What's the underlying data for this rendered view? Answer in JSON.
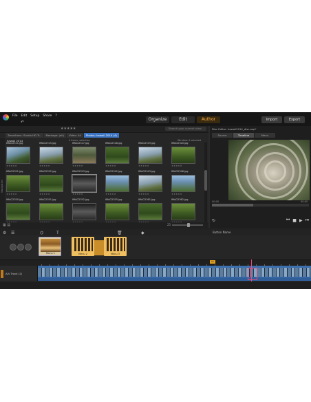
{
  "menu": [
    "File",
    "Edit",
    "Setup",
    "Share",
    "?"
  ],
  "modes": {
    "organize": "Organize",
    "edit": "Edit",
    "author": "Author"
  },
  "actions": {
    "import": "Import",
    "export": "Export"
  },
  "library": {
    "stars": "★★★★★",
    "search_placeholder": "Search your current view",
    "tabs": [
      "Transitions: Studio HD Tr..",
      "Montage: (all)",
      "Video: All",
      "Photos: hawaii 2014 (4)"
    ],
    "sub_header": "hawaii 2014",
    "info_left": "4 items, selection",
    "info_right": "Window: 4 selected",
    "navigation": "Navigation",
    "rows": [
      {
        "files": [
          "IMAG2311.jpg",
          "IMAG2315.jpg",
          "IMAG2317.jpg",
          "IMAG2318.jpg",
          "IMAG2319.jpg",
          "IMAG2320.jpg"
        ],
        "thumbs": [
          "g1",
          "g3",
          "g4",
          "g5",
          "g3",
          "g2"
        ],
        "sel": []
      },
      {
        "files": [
          "IMAG2321.jpg",
          "IMAG2322.jpg",
          "IMAG2323.jpg",
          "IMAG2342.jpg",
          "IMAG2343.jpg",
          "IMAG2348.jpg"
        ],
        "thumbs": [
          "g2",
          "g5",
          "g6",
          "g7",
          "g3",
          "g7"
        ],
        "sel": [
          2
        ]
      },
      {
        "files": [
          "IMAG2350.jpg",
          "IMAG2351.jpg",
          "IMAG2352.jpg",
          "IMAG2355.jpg",
          "IMAG2361.jpg",
          "IMAG2362.jpg"
        ],
        "thumbs": [
          "g5",
          "g2",
          "g6",
          "g2",
          "g5",
          "g2"
        ],
        "sel": []
      }
    ],
    "rating": "★★★★★",
    "zoom_label": "25"
  },
  "player": {
    "title": "Disc Editor: hawaii2014_disc.axp*",
    "tabs": [
      "Source",
      "Timeline",
      "Menu"
    ],
    "time_left": "00:00",
    "time_right": "00:00"
  },
  "timeline": {
    "button_name": "Button Name",
    "menus": [
      "Menu 1",
      "Menu 2",
      "Menu 3"
    ],
    "ruler_label": "A/V Track (2)",
    "marker": "Ch",
    "track_name": "A/V Track (2)"
  },
  "icons": {
    "undo": "↶",
    "play": "▶",
    "prev": "⏮",
    "next": "⏭",
    "stop": "■",
    "loop": "↻"
  }
}
